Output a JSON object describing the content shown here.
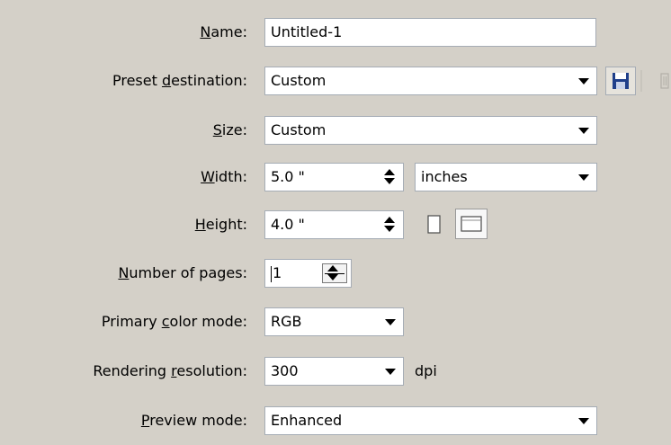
{
  "name": {
    "label_pre": "",
    "label_key": "N",
    "label_post": "ame:",
    "value": "Untitled-1"
  },
  "preset": {
    "label_pre": "Preset ",
    "label_key": "d",
    "label_post": "estination:",
    "value": "Custom"
  },
  "size": {
    "label_pre": "",
    "label_key": "S",
    "label_post": "ize:",
    "value": "Custom"
  },
  "width": {
    "label_pre": "",
    "label_key": "W",
    "label_post": "idth:",
    "value": "5.0 \"",
    "unit": "inches"
  },
  "height": {
    "label_pre": "",
    "label_key": "H",
    "label_post": "eight:",
    "value": "4.0 \""
  },
  "pages": {
    "label_pre": "",
    "label_key": "N",
    "label_post": "umber of pages:",
    "value": "1"
  },
  "color_mode": {
    "label_pre": "Primary ",
    "label_key": "c",
    "label_post": "olor mode:",
    "value": "RGB"
  },
  "resolution": {
    "label_pre": "Rendering ",
    "label_key": "r",
    "label_post": "esolution:",
    "value": "300",
    "unit": "dpi"
  },
  "preview": {
    "label_pre": "",
    "label_key": "P",
    "label_post": "review mode:",
    "value": "Enhanced"
  },
  "icons": {
    "save": "save-icon",
    "delete": "delete-icon",
    "portrait": "portrait-icon",
    "landscape": "landscape-icon"
  },
  "colors": {
    "panel": "#d4d0c8",
    "field_border": "#a5acb5",
    "save_icon": "#1f3f8a"
  }
}
